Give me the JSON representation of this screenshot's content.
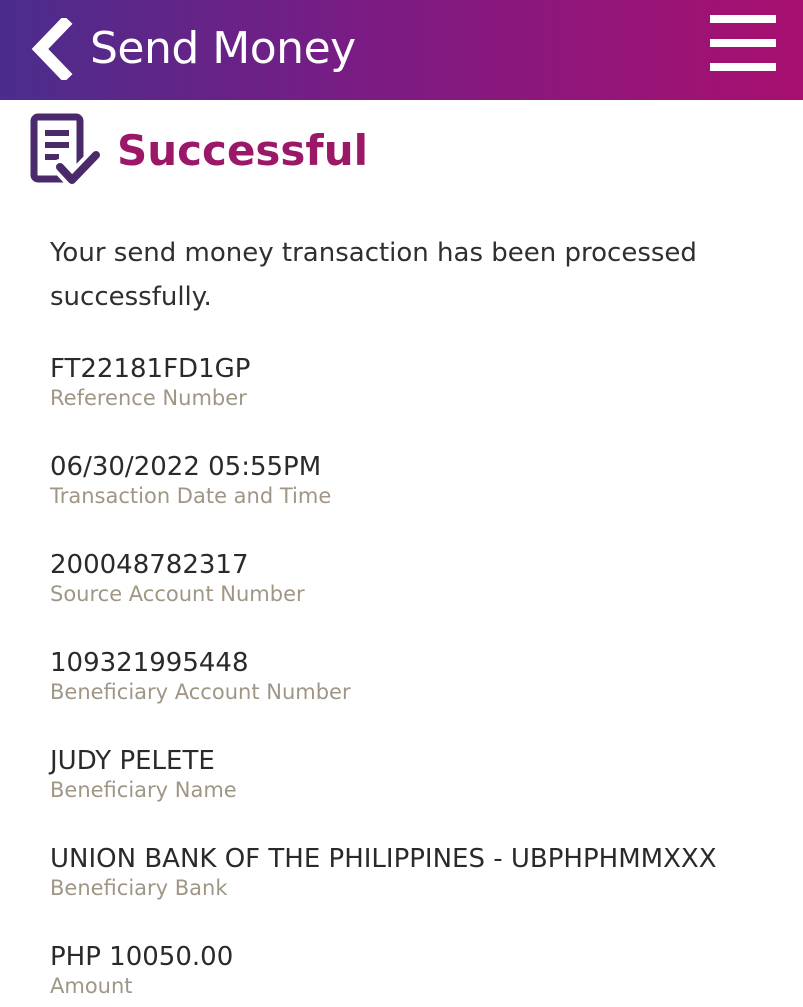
{
  "header": {
    "back_icon": "chevron-left-icon",
    "title": "Send Money",
    "menu_icon": "hamburger-menu-icon",
    "gradient_start": "#4a2d8c",
    "gradient_end": "#a8106f"
  },
  "status": {
    "icon": "document-check-icon",
    "title": "Successful",
    "accent_color": "#9b1768",
    "message": "Your send money transaction has been processed successfully."
  },
  "details": [
    {
      "value": "FT22181FD1GP",
      "label": "Reference Number"
    },
    {
      "value": "06/30/2022 05:55PM",
      "label": "Transaction Date and Time"
    },
    {
      "value": "200048782317",
      "label": "Source Account Number"
    },
    {
      "value": "109321995448",
      "label": "Beneficiary Account Number"
    },
    {
      "value": "JUDY PELETE",
      "label": "Beneficiary Name"
    },
    {
      "value": "UNION BANK OF THE PHILIPPINES - UBPHPHMMXXX",
      "label": "Beneficiary Bank"
    },
    {
      "value": "PHP 10050.00",
      "label": "Amount"
    }
  ]
}
